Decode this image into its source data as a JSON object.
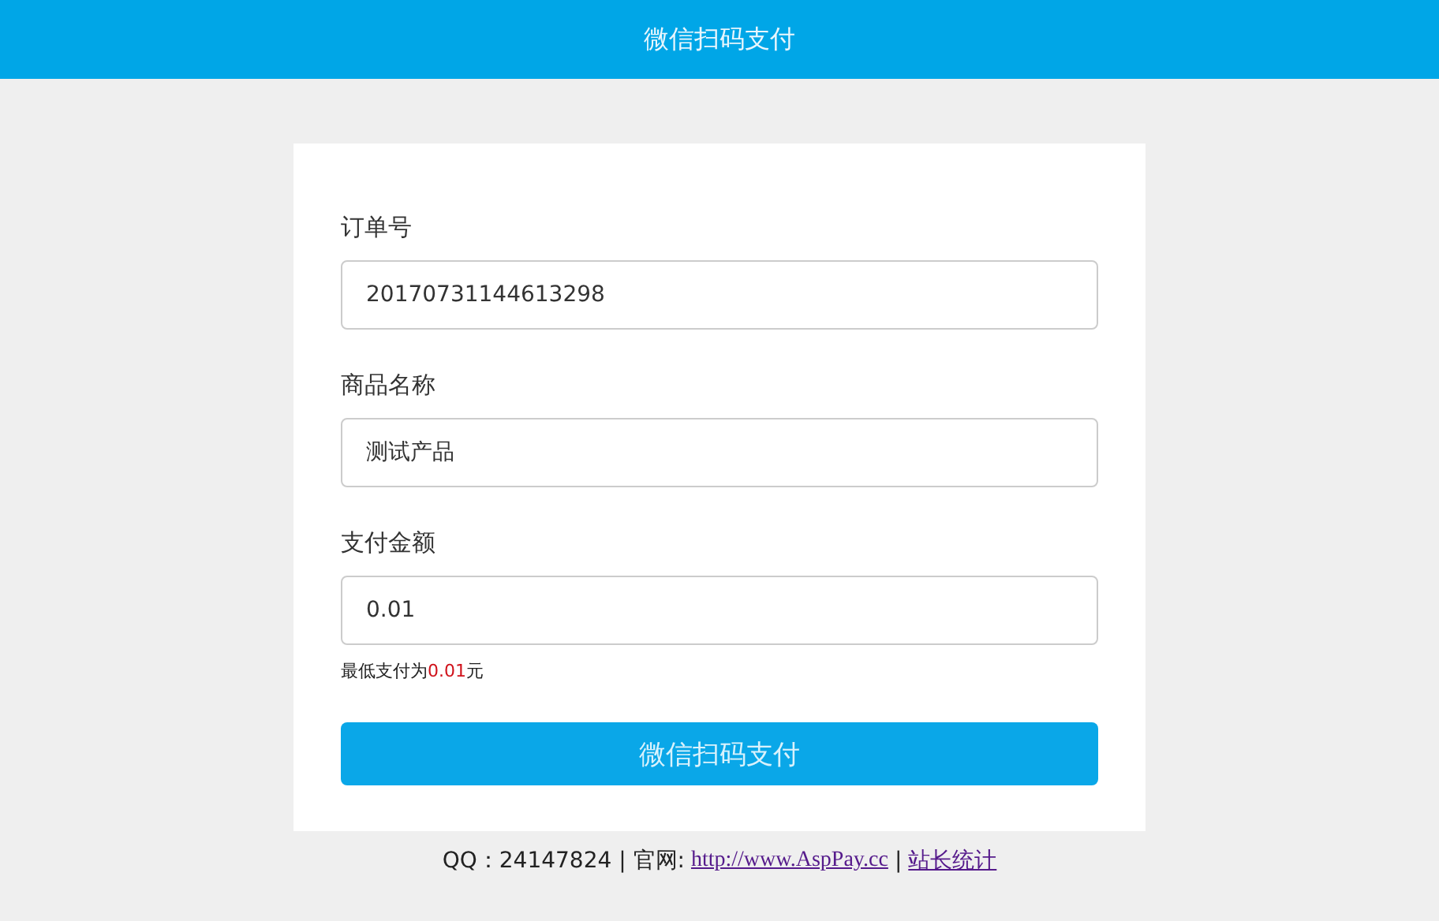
{
  "header": {
    "title": "微信扫码支付"
  },
  "form": {
    "fields": [
      {
        "label": "订单号",
        "value": "20170731144613298"
      },
      {
        "label": "商品名称",
        "value": "测试产品"
      },
      {
        "label": "支付金额",
        "value": "0.01"
      }
    ],
    "note": {
      "prefix": "最低支付为",
      "amount": "0.01",
      "suffix": "元"
    },
    "submit": "微信扫码支付"
  },
  "footer": {
    "text": "QQ：24147824 | 官网:",
    "site_link": "http://www.AspPay.cc",
    "separator": "|",
    "stats_link": "站长统计"
  }
}
